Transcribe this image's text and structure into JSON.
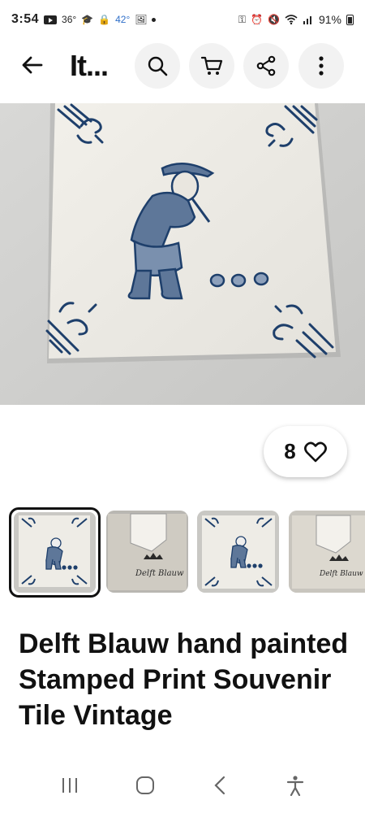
{
  "status_bar": {
    "time": "3:54",
    "notif_text": "36°",
    "temperature": "42°",
    "battery": "91%"
  },
  "header": {
    "title": "It...",
    "icons": [
      "back-arrow-icon",
      "search-icon",
      "cart-icon",
      "share-icon",
      "more-vert-icon"
    ]
  },
  "like": {
    "count": "8"
  },
  "product": {
    "title": "Delft Blauw hand painted Stamped Print Souvenir Tile Vintage"
  },
  "thumbnails": [
    {
      "kind": "tile",
      "selected": true
    },
    {
      "kind": "back",
      "stamp": "Delft Blauw"
    },
    {
      "kind": "tile",
      "selected": false
    },
    {
      "kind": "back",
      "stamp": "Delft Blauw"
    }
  ],
  "colors": {
    "accent": "#1e3f6b",
    "ink": "#111111"
  }
}
